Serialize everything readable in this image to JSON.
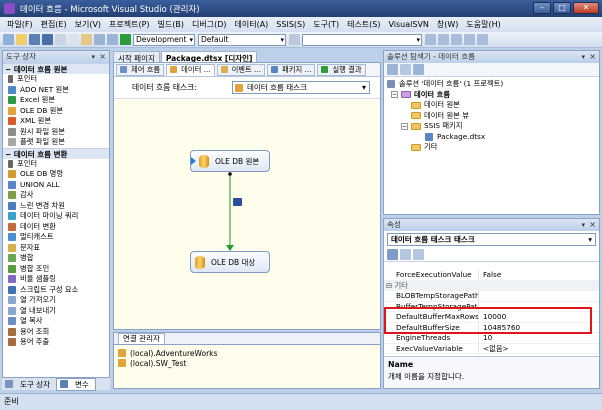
{
  "window": {
    "title": "데이터 흐름 - Microsoft Visual Studio (관리자)"
  },
  "menu": [
    "파일(F)",
    "편집(E)",
    "보기(V)",
    "프로젝트(P)",
    "빌드(B)",
    "디버그(D)",
    "데이터(A)",
    "SSIS(S)",
    "도구(T)",
    "테스트(S)",
    "VisualSVN",
    "창(W)",
    "도움말(H)"
  ],
  "toolbar": {
    "config": "Development",
    "platform": "Default"
  },
  "toolbox": {
    "title": "도구 상자",
    "groups": [
      {
        "name": "데이터 흐름 원본",
        "items": [
          "포인터",
          "ADO NET 원본",
          "Excel 원본",
          "OLE DB 원본",
          "XML 원본",
          "원시 파일 원본",
          "플랫 파일 원본"
        ]
      },
      {
        "name": "데이터 흐름 변환",
        "items": [
          "포인터",
          "OLE DB 명령",
          "UNION ALL",
          "감사",
          "느린 변경 차원",
          "데이터 마이닝 쿼리",
          "데이터 변환",
          "멀티캐스트",
          "문자표",
          "병합",
          "병합 조인",
          "비율 샘플링",
          "스크립트 구성 요소",
          "열 가져오기",
          "열 내보내기",
          "열 복사",
          "용어 조회",
          "용어 추출"
        ]
      }
    ],
    "tabs": [
      "도구 상자",
      "변수"
    ]
  },
  "doc_tabs": [
    "시작 페이지",
    "Package.dtsx [디자인]"
  ],
  "design_tabs": [
    "제어 흐름",
    "데이터 ...",
    "이벤트 ...",
    "패키지 ...",
    "실행 결과"
  ],
  "task": {
    "label": "데이터 흐름 태스크:",
    "value": "데이터 흐름 태스크"
  },
  "components": {
    "source": "OLE DB 원본",
    "dest": "OLE DB 대상"
  },
  "connections": {
    "title": "연결 관리자",
    "items": [
      "(local).AdventureWorks",
      "(local).SW_Test"
    ]
  },
  "solution": {
    "title": "솔루션 탐색기 - 데이터 흐름",
    "root": "솔루션 '데이터 흐름' (1 프로젝트)",
    "project": "데이터 흐름",
    "items": [
      "데이터 원본",
      "데이터 원본 뷰",
      "SSIS 패키지",
      "Package.dtsx",
      "기타"
    ]
  },
  "properties": {
    "title": "속성",
    "object": "데이터 흐름 태스크 태스크",
    "rows": [
      {
        "name": "ForceExecutionValue",
        "value": "False"
      },
      {
        "category": "기타"
      },
      {
        "name": "BLOBTempStoragePath",
        "value": ""
      },
      {
        "name": "BufferTempStoragePath",
        "value": ""
      },
      {
        "name": "DefaultBufferMaxRows",
        "value": "10000"
      },
      {
        "name": "DefaultBufferSize",
        "value": "10485760"
      },
      {
        "name": "EngineThreads",
        "value": "10"
      },
      {
        "name": "ExecValueVariable",
        "value": "<없음>"
      }
    ],
    "desc_title": "Name",
    "desc_text": "개체 이름을 지정합니다."
  },
  "status": "준비",
  "colors": {
    "accent": "#e0151b",
    "flow_arrow": "#1f9b2b",
    "canvas": "#fffdeb"
  }
}
